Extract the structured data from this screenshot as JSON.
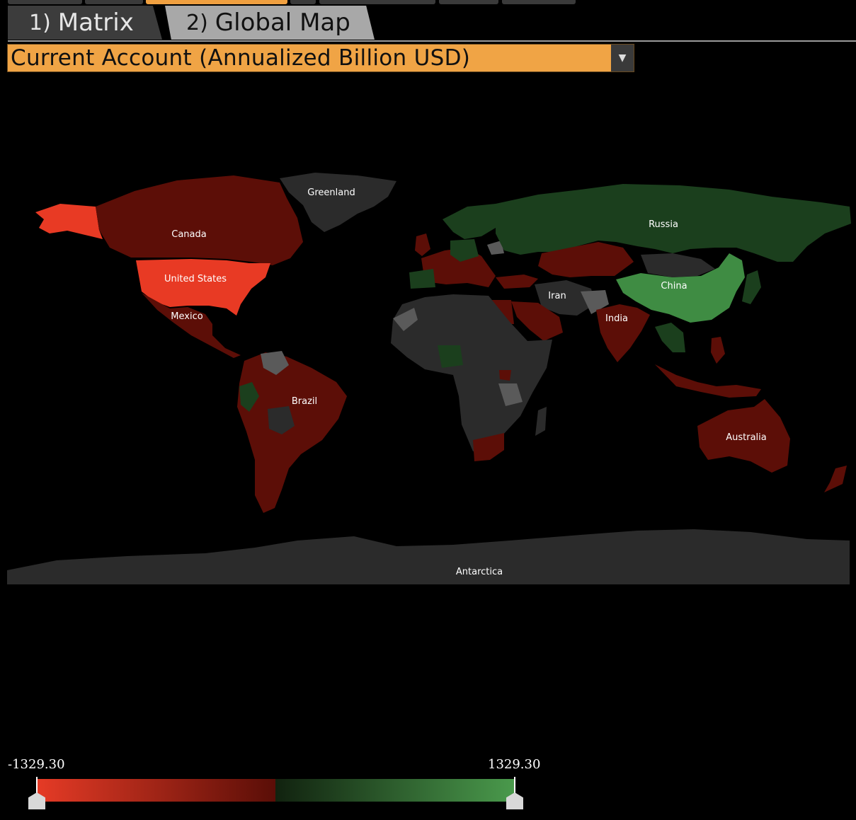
{
  "tabs": [
    {
      "num": "1)",
      "label": "Matrix",
      "active": false
    },
    {
      "num": "2)",
      "label": "Global Map",
      "active": true
    }
  ],
  "metric_select": {
    "value": "Current Account (Annualized Billion USD)"
  },
  "map": {
    "labels": {
      "greenland": "Greenland",
      "canada": "Canada",
      "united_states": "United States",
      "mexico": "Mexico",
      "brazil": "Brazil",
      "russia": "Russia",
      "china": "China",
      "iran": "Iran",
      "india": "India",
      "australia": "Australia",
      "antarctica": "Antarctica"
    },
    "colors": {
      "deficit_strong": "#e83a24",
      "deficit": "#5c0e07",
      "surplus": "#1b3f1d",
      "surplus_strong": "#3f8c43",
      "no_data": "#2b2b2b",
      "neutral_light": "#5a5a5a"
    }
  },
  "legend": {
    "min": "-1329.30",
    "max": "1329.30",
    "neg_colors": [
      "#e63b26",
      "#5a0e07"
    ],
    "pos_colors": [
      "#11220f",
      "#4a9a4c"
    ]
  }
}
